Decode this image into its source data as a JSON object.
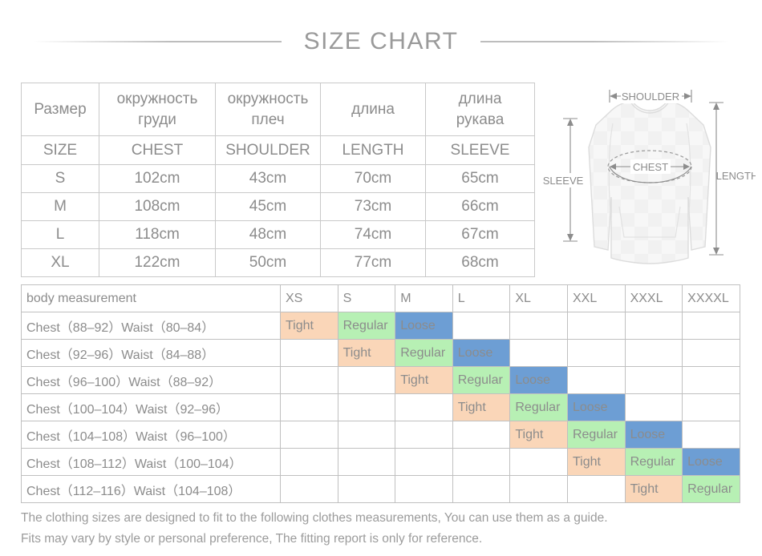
{
  "header": {
    "title": "SIZE CHART"
  },
  "size_table": {
    "columns_ru": [
      "Размер",
      [
        "окружность",
        "груди"
      ],
      [
        "окружность",
        "плеч"
      ],
      [
        "длина"
      ],
      [
        "длина",
        "рукава"
      ]
    ],
    "columns_en": [
      "SIZE",
      "CHEST",
      "SHOULDER",
      "LENGTH",
      "SLEEVE"
    ],
    "rows": [
      {
        "size": "S",
        "chest": "102cm",
        "shoulder": "43cm",
        "length": "70cm",
        "sleeve": "65cm"
      },
      {
        "size": "M",
        "chest": "108cm",
        "shoulder": "45cm",
        "length": "73cm",
        "sleeve": "66cm"
      },
      {
        "size": "L",
        "chest": "118cm",
        "shoulder": "48cm",
        "length": "74cm",
        "sleeve": "67cm"
      },
      {
        "size": "XL",
        "chest": "122cm",
        "shoulder": "50cm",
        "length": "77cm",
        "sleeve": "68cm"
      }
    ]
  },
  "diagram": {
    "shoulder_label": "SHOULDER",
    "chest_label": "CHEST",
    "sleeve_label": "SLEEVE",
    "length_label": "LENGTH"
  },
  "fit_table": {
    "label_header": "body measurement",
    "size_headers": [
      "XS",
      "S",
      "M",
      "L",
      "XL",
      "XXL",
      "XXXL",
      "XXXXL"
    ],
    "fit_terms": {
      "tight": "Tight",
      "regular": "Regular",
      "loose": "Loose"
    },
    "rows": [
      {
        "label": "Chest（88–92）Waist（80–84）",
        "fits": [
          "Tight",
          "Regular",
          "Loose",
          "",
          "",
          "",
          "",
          ""
        ]
      },
      {
        "label": "Chest（92–96）Waist（84–88）",
        "fits": [
          "",
          "Tight",
          "Regular",
          "Loose",
          "",
          "",
          "",
          ""
        ]
      },
      {
        "label": "Chest（96–100）Waist（88–92）",
        "fits": [
          "",
          "",
          "Tight",
          "Regular",
          "Loose",
          "",
          "",
          ""
        ]
      },
      {
        "label": "Chest（100–104）Waist（92–96）",
        "fits": [
          "",
          "",
          "",
          "Tight",
          "Regular",
          "Loose",
          "",
          ""
        ]
      },
      {
        "label": "Chest（104–108）Waist（96–100）",
        "fits": [
          "",
          "",
          "",
          "",
          "Tight",
          "Regular",
          "Loose",
          ""
        ]
      },
      {
        "label": "Chest（108–112）Waist（100–104）",
        "fits": [
          "",
          "",
          "",
          "",
          "",
          "Tight",
          "Regular",
          "Loose"
        ]
      },
      {
        "label": "Chest（112–116）Waist（104–108）",
        "fits": [
          "",
          "",
          "",
          "",
          "",
          "",
          "Tight",
          "Regular"
        ]
      }
    ]
  },
  "footer": {
    "line1": "The clothing sizes are designed to fit to the following clothes measurements, You can use them as a guide.",
    "line2": "Fits may vary by style or personal preference, The fitting report is only for reference."
  },
  "colors": {
    "tight": "#fad6b8",
    "regular": "#b7f0b4",
    "loose": "#6d9ed4",
    "text": "#8c8c8c",
    "border": "#c3c3c3"
  }
}
